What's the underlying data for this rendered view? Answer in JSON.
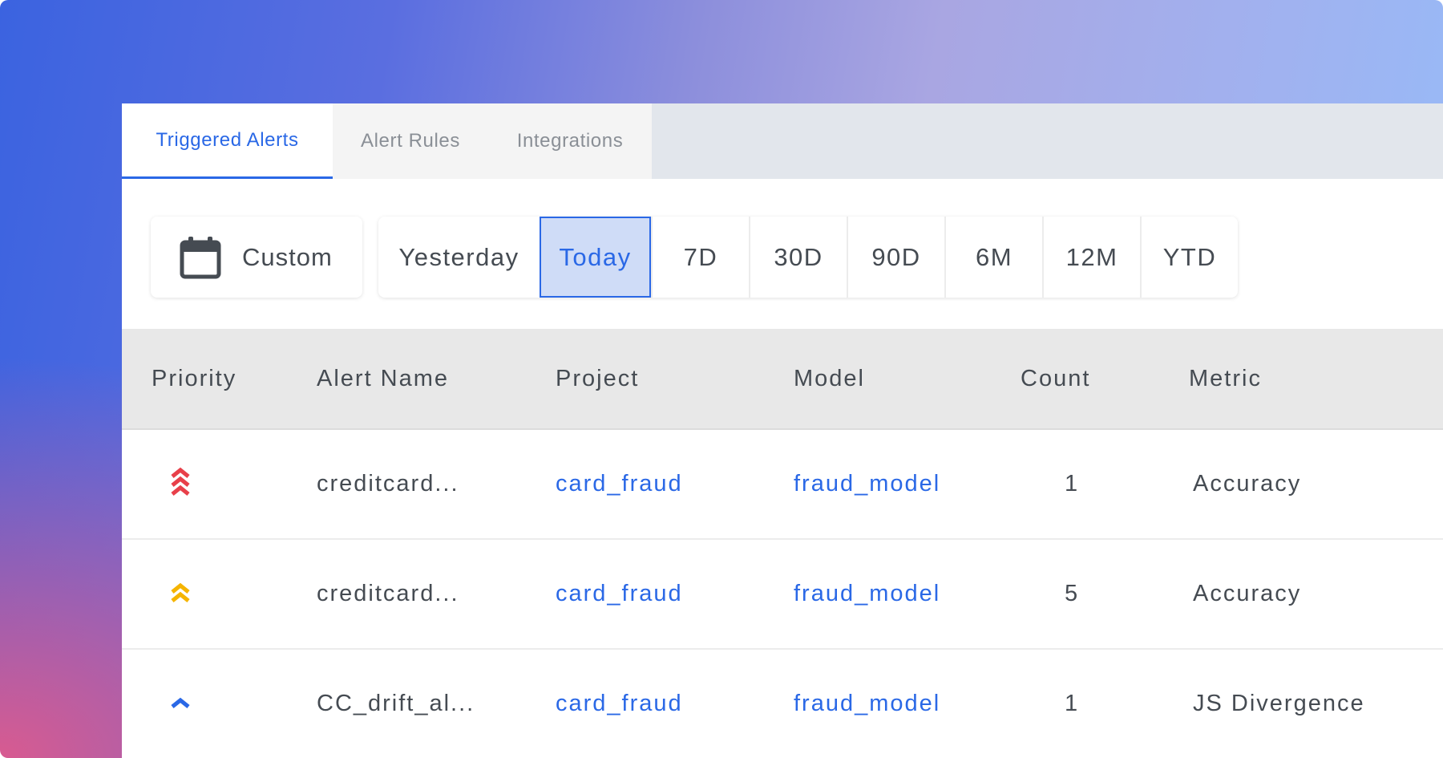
{
  "tabs": [
    {
      "label": "Triggered Alerts",
      "active": true
    },
    {
      "label": "Alert Rules",
      "active": false
    },
    {
      "label": "Integrations",
      "active": false
    }
  ],
  "range": {
    "custom_label": "Custom",
    "custom_icon": "calendar-icon",
    "options": [
      "Yesterday",
      "Today",
      "7D",
      "30D",
      "90D",
      "6M",
      "12M",
      "YTD"
    ],
    "selected": "Today"
  },
  "table": {
    "headers": [
      "Priority",
      "Alert Name",
      "Project",
      "Model",
      "Count",
      "Metric"
    ],
    "rows": [
      {
        "priority": "high",
        "priority_icon": "triple-chevron-up-icon",
        "alert_name": "creditcard...",
        "project": "card_fraud",
        "model": "fraud_model",
        "count": "1",
        "metric": "Accuracy"
      },
      {
        "priority": "medium",
        "priority_icon": "double-chevron-up-icon",
        "alert_name": "creditcard...",
        "project": "card_fraud",
        "model": "fraud_model",
        "count": "5",
        "metric": "Accuracy"
      },
      {
        "priority": "low",
        "priority_icon": "chevron-up-icon",
        "alert_name": "CC_drift_al...",
        "project": "card_fraud",
        "model": "fraud_model",
        "count": "1",
        "metric": "JS Divergence"
      }
    ]
  },
  "colors": {
    "accent": "#2a68e6",
    "priority_high": "#e8404a",
    "priority_medium": "#f5b400",
    "priority_low": "#2a68e6"
  }
}
